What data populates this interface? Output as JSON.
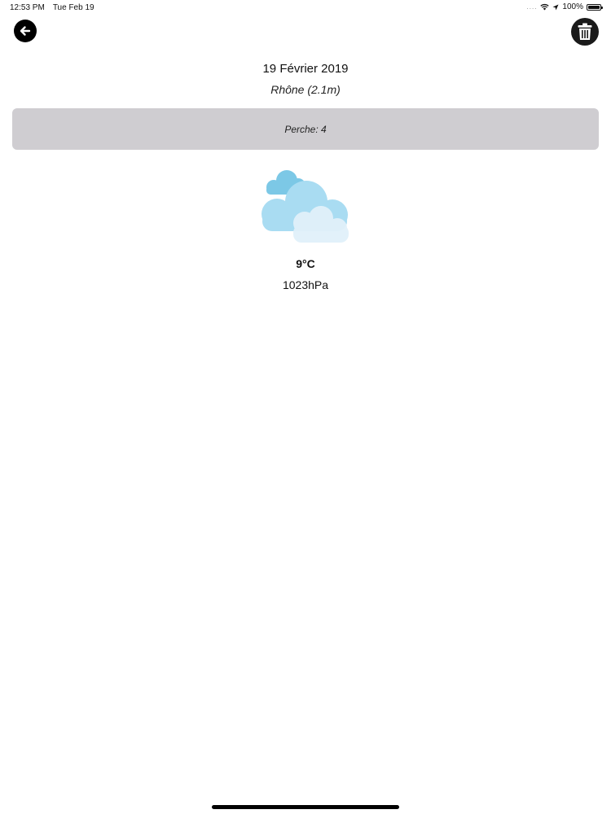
{
  "status_bar": {
    "time": "12:53 PM",
    "date": "Tue Feb 19",
    "signal": "....",
    "battery_percent": "100%"
  },
  "header": {
    "date_title": "19 Février 2019",
    "river": "Rhône (2.1m)"
  },
  "catch": {
    "label": "Perche: 4"
  },
  "weather": {
    "icon": "cloudy-icon",
    "temperature": "9°C",
    "pressure": "1023hPa"
  },
  "icons": {
    "back": "arrow-left-icon",
    "delete": "trash-icon"
  },
  "colors": {
    "panel_background": "#cfcdd1",
    "cloud_light": "#a9dcf2",
    "cloud_dark": "#7cc8e6",
    "cloud_pale": "#e1f1fa"
  }
}
